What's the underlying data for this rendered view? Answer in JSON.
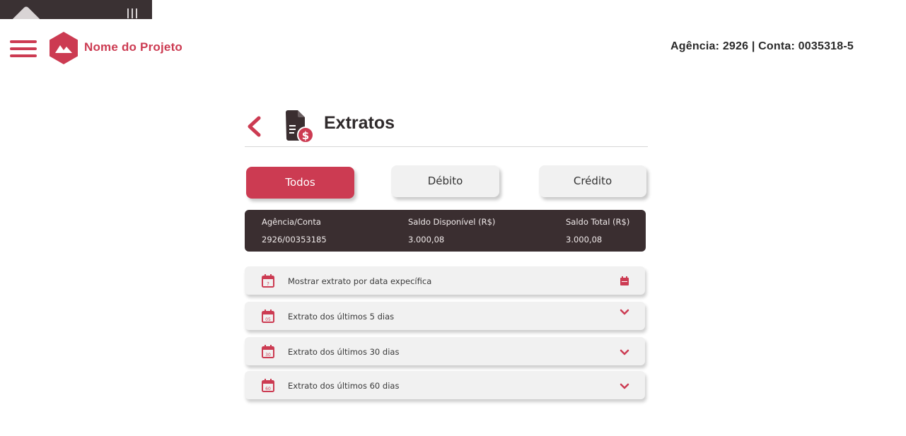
{
  "header": {
    "project_name": "Nome do Projeto",
    "account_info": "Agência: 2926  |  Conta: 0035318-5"
  },
  "page": {
    "title": "Extratos"
  },
  "tabs": [
    {
      "label": "Todos",
      "active": true
    },
    {
      "label": "Débito",
      "active": false
    },
    {
      "label": "Crédito",
      "active": false
    }
  ],
  "summary": {
    "agencia_conta_label": "Agência/Conta",
    "agencia_conta_value": "2926/00353185",
    "saldo_disponivel_label": "Saldo Disponível (R$)",
    "saldo_disponivel_value": "3.000,08",
    "saldo_total_label": "Saldo Total (R$)",
    "saldo_total_value": "3.000,08"
  },
  "options": [
    {
      "label": "Mostrar extrato por data expecífica",
      "badge": "?",
      "right_icon": "calendar-icon"
    },
    {
      "label": "Extrato dos últimos 5 dias",
      "badge": "05",
      "right_icon": "chevron-down-icon"
    },
    {
      "label": "Extrato dos últimos 30 dias",
      "badge": "30",
      "right_icon": "chevron-down-icon"
    },
    {
      "label": "Extrato dos últimos 60 dias",
      "badge": "60",
      "right_icon": "chevron-down-icon"
    }
  ],
  "colors": {
    "accent": "#cc3b52",
    "dark": "#3a2e30",
    "panel": "#f1f1f1"
  }
}
